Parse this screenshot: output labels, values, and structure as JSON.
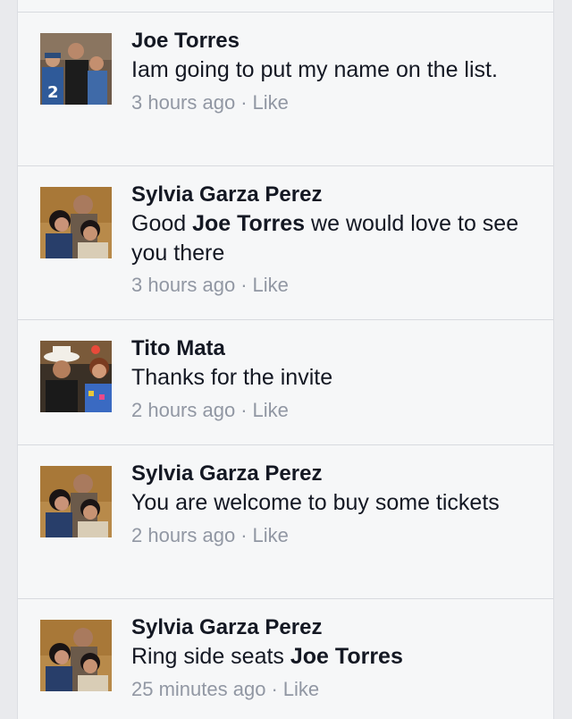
{
  "comments": [
    {
      "author": "Joe Torres",
      "text_parts": [
        {
          "t": "Iam going to put my name on the list.",
          "b": false
        }
      ],
      "time": "3 hours ago",
      "dot": "·",
      "like": "Like",
      "avatar_icon": "photo-group-avatar"
    },
    {
      "author": "Sylvia Garza Perez",
      "text_parts": [
        {
          "t": "Good ",
          "b": false
        },
        {
          "t": "Joe Torres",
          "b": true
        },
        {
          "t": " we would love to see you there",
          "b": false
        }
      ],
      "time": "3 hours ago",
      "dot": "·",
      "like": "Like",
      "avatar_icon": "photo-couple-avatar"
    },
    {
      "author": "Tito Mata",
      "text_parts": [
        {
          "t": "Thanks for the invite",
          "b": false
        }
      ],
      "time": "2 hours ago",
      "dot": "·",
      "like": "Like",
      "avatar_icon": "photo-couple-hat-avatar"
    },
    {
      "author": "Sylvia Garza Perez",
      "text_parts": [
        {
          "t": "You are welcome to  buy some tickets",
          "b": false
        }
      ],
      "time": "2 hours ago",
      "dot": "·",
      "like": "Like",
      "avatar_icon": "photo-couple-avatar"
    },
    {
      "author": "Sylvia Garza Perez",
      "text_parts": [
        {
          "t": "Ring side seats ",
          "b": false
        },
        {
          "t": "Joe Torres",
          "b": true
        }
      ],
      "time": "25 minutes ago",
      "dot": "·",
      "like": "Like",
      "avatar_icon": "photo-couple-avatar"
    }
  ]
}
